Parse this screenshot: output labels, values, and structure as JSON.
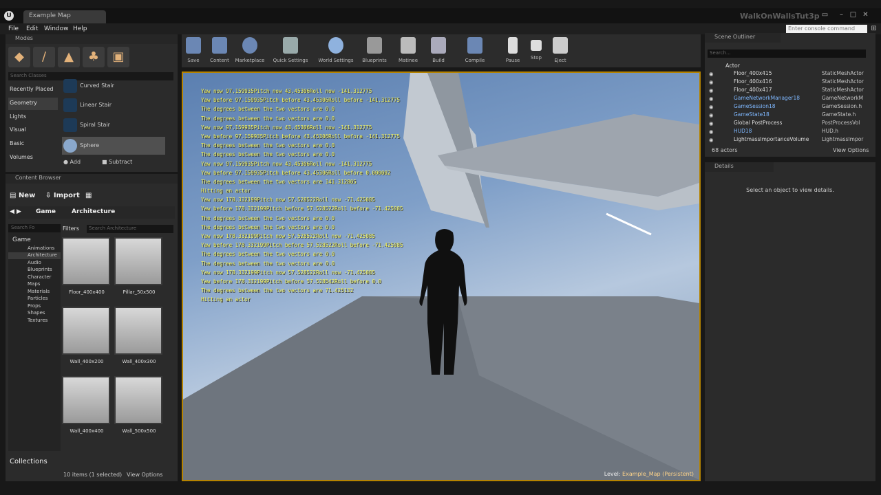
{
  "window": {
    "tab": "Example Map",
    "project": "WalkOnWallsTut3p",
    "logo": "U"
  },
  "menu": [
    "File",
    "Edit",
    "Window",
    "Help"
  ],
  "console_placeholder": "Enter console command",
  "modes": {
    "tab": "Modes",
    "search_placeholder": "Search Classes",
    "categories": [
      "Recently Placed",
      "Geometry",
      "Lights",
      "Visual",
      "Basic",
      "Volumes"
    ],
    "selected_category": "Geometry",
    "items": [
      "Curved Stair",
      "Linear Stair",
      "Spiral Stair",
      "Sphere"
    ],
    "selected_item": "Sphere",
    "add_label": "Add",
    "subtract_label": "Subtract"
  },
  "content_browser": {
    "tab": "Content Browser",
    "new_label": "New",
    "import_label": "Import",
    "breadcrumb": [
      "Game",
      "Architecture"
    ],
    "tree_search": "Search Fo",
    "filters_label": "Filters",
    "asset_search": "Search Architecture",
    "tree_root": "Game",
    "tree": [
      "Animations",
      "Architecture",
      "Audio",
      "Blueprints",
      "Character",
      "Maps",
      "Materials",
      "Particles",
      "Props",
      "Shapes",
      "Textures"
    ],
    "assets": [
      "Floor_400x400",
      "Pillar_50x500",
      "Wall_400x200",
      "Wall_400x300",
      "Wall_400x400",
      "Wall_500x500"
    ],
    "status": "10 items (1 selected)",
    "view_options": "View Options",
    "collections": "Collections"
  },
  "toolbar": [
    "Save",
    "Content",
    "Marketplace",
    "Quick Settings",
    "World Settings",
    "Blueprints",
    "Matinee",
    "Build",
    "Compile",
    "Pause",
    "Stop",
    "Eject"
  ],
  "viewport": {
    "log": [
      "Yaw now 97.159935Pitch now 43.45306Roll now -141.312775",
      "Yaw before 97.159935Pitch before 43.45306Roll before -141.312775",
      "The degrees between the two vectors are 0.0",
      "The degrees between the two vectors are 0.0",
      "Yaw now 97.159935Pitch now 43.45306Roll now -141.312775",
      "Yaw before 97.159935Pitch before 43.45306Roll before -141.312775",
      "The degrees between the two vectors are 0.0",
      "The degrees between the two vectors are 0.0",
      "Yaw now 97.159935Pitch now 43.45306Roll now -141.312775",
      "Yaw before 97.159935Pitch before 43.45306Roll before 0.000002",
      "The degrees between the two vectors are 141.312805",
      "Hitting an actor",
      "Yaw now 178.332199Pitch now 57.528522Roll now -71.425085",
      "Yaw before 178.332199Pitch before 57.528522Roll before -71.425085",
      "The degrees between the two vectors are 0.0",
      "The degrees between the two vectors are 0.0",
      "Yaw now 178.332199Pitch now 57.528522Roll now -71.425085",
      "Yaw before 178.332199Pitch before 57.528522Roll before -71.425085",
      "The degrees between the two vectors are 0.0",
      "The degrees between the two vectors are 0.0",
      "Yaw now 178.332199Pitch now 57.528522Roll now -71.425085",
      "Yaw before 178.332199Pitch before 57.528542Roll before 0.0",
      "The degrees between the two vectors are 71.425132",
      "Hitting an actor"
    ],
    "level_label": "Level:",
    "level_name": "Example_Map (Persistent)"
  },
  "outliner": {
    "tab": "Scene Outliner",
    "search_placeholder": "Search...",
    "col_actor": "Actor",
    "rows": [
      {
        "name": "Floor_400x415",
        "type": "StaticMeshActor",
        "blue": false
      },
      {
        "name": "Floor_400x416",
        "type": "StaticMeshActor",
        "blue": false
      },
      {
        "name": "Floor_400x417",
        "type": "StaticMeshActor",
        "blue": false
      },
      {
        "name": "GameNetworkManager18",
        "type": "GameNetworkM",
        "blue": true
      },
      {
        "name": "GameSession18",
        "type": "GameSession.h",
        "blue": true
      },
      {
        "name": "GameState18",
        "type": "GameState.h",
        "blue": true
      },
      {
        "name": "Global PostProcess",
        "type": "PostProcessVol",
        "blue": false
      },
      {
        "name": "HUD18",
        "type": "HUD.h",
        "blue": true
      },
      {
        "name": "LightmassImportanceVolume",
        "type": "LightmassImpor",
        "blue": false
      }
    ],
    "count": "68 actors",
    "view_options": "View Options"
  },
  "details": {
    "tab": "Details",
    "empty_msg": "Select an object to view details."
  }
}
